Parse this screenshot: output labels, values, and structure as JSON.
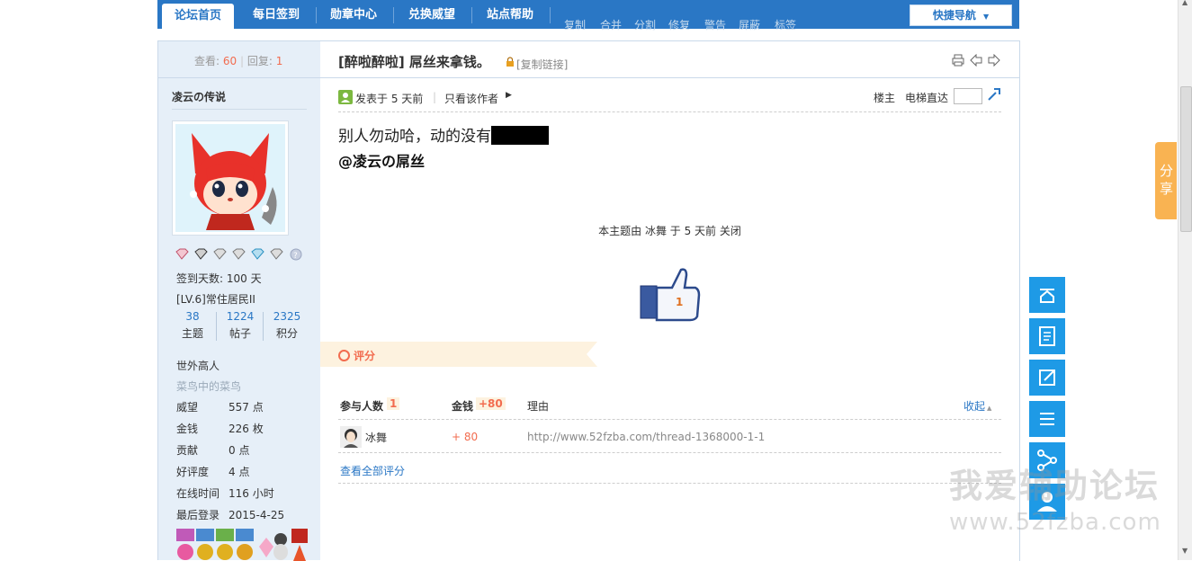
{
  "nav": {
    "tabs": [
      {
        "label": "论坛首页"
      },
      {
        "label": "每日签到"
      },
      {
        "label": "勋章中心"
      },
      {
        "label": "兑换威望"
      },
      {
        "label": "站点帮助"
      }
    ],
    "quick_nav": "快捷导航",
    "ghost_items": [
      "复制",
      "合并",
      "分割",
      "修复",
      "警告",
      "屏蔽",
      "标签"
    ]
  },
  "thread": {
    "views_label": "查看:",
    "views": "60",
    "replies_label": "回复:",
    "replies": "1",
    "title": "[醉啦醉啦] 屌丝来拿钱。",
    "copy_link": "[复制链接]",
    "author": "凌云の传说",
    "posted": "发表于 5 天前",
    "only_author": "只看该作者",
    "floor": "楼主",
    "elevator": "电梯直达",
    "body_line1": "别人勿动哈，动的没有",
    "body_line2": "@凌云の屌丝",
    "closed_notice": "本主题由 冰舞 于 5 天前 关闭",
    "like_count": "1"
  },
  "profile": {
    "signin_days": "签到天数: 100 天",
    "level": "[LV.6]常住居民II",
    "stats": [
      {
        "value": "38",
        "label": "主题"
      },
      {
        "value": "1224",
        "label": "帖子"
      },
      {
        "value": "2325",
        "label": "积分"
      }
    ],
    "group": "世外高人",
    "subtitle": "菜鸟中的菜鸟",
    "fields": [
      {
        "key": "威望",
        "value": "557 点"
      },
      {
        "key": "金钱",
        "value": "226 枚"
      },
      {
        "key": "贡献",
        "value": "0 点"
      },
      {
        "key": "好评度",
        "value": "4 点"
      },
      {
        "key": "在线时间",
        "value": "116 小时"
      },
      {
        "key": "最后登录",
        "value": "2015-4-25"
      }
    ]
  },
  "rating": {
    "title": "评分",
    "participants_label": "参与人数",
    "participants": "1",
    "money_label": "金钱",
    "money_total": "+80",
    "reason_label": "理由",
    "collapse": "收起",
    "row_user": "冰舞",
    "row_value": "+ 80",
    "row_reason": "http://www.52fzba.com/thread-1368000-1-1",
    "view_all": "查看全部评分"
  },
  "share_tab": "分享",
  "watermark": {
    "line1": "我爱辅助论坛",
    "line2": "www.52fzba.com"
  },
  "colors": {
    "nav_blue": "#2a77c5",
    "accent_orange": "#f26c4f",
    "side_button": "#1e9ae6"
  }
}
